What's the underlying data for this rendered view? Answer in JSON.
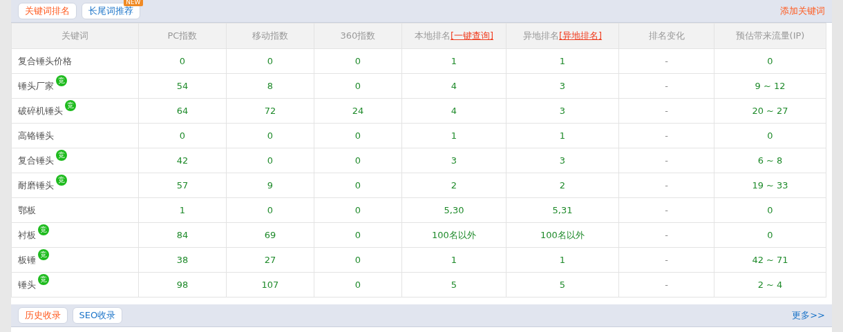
{
  "top_panel": {
    "tabs": [
      {
        "label": "关键词排名",
        "selected": true
      },
      {
        "label": "长尾词推荐",
        "selected": false,
        "badge": "NEW"
      }
    ],
    "action_link": "添加关键词"
  },
  "table": {
    "columns": [
      {
        "label": "关键词"
      },
      {
        "label": "PC指数"
      },
      {
        "label": "移动指数"
      },
      {
        "label": "360指数"
      },
      {
        "label": "本地排名",
        "link": "[一键查询]"
      },
      {
        "label": "异地排名",
        "link": "[异地排名]"
      },
      {
        "label": "排名变化"
      },
      {
        "label": "预估带来流量(IP)"
      }
    ],
    "rows": [
      {
        "keyword": "复合锤头价格",
        "pc": "0",
        "mobile": "0",
        "s360": "0",
        "local": "1",
        "remote": "1",
        "change": "-",
        "traffic": "0"
      },
      {
        "keyword": "锤头厂家",
        "badge": "竞",
        "pc": "54",
        "mobile": "8",
        "s360": "0",
        "local": "4",
        "remote": "3",
        "change": "-",
        "traffic": "9 ~ 12"
      },
      {
        "keyword": "破碎机锤头",
        "badge": "竞",
        "pc": "64",
        "mobile": "72",
        "s360": "24",
        "local": "4",
        "remote": "3",
        "change": "-",
        "traffic": "20 ~ 27"
      },
      {
        "keyword": "高铬锤头",
        "pc": "0",
        "mobile": "0",
        "s360": "0",
        "local": "1",
        "remote": "1",
        "change": "-",
        "traffic": "0"
      },
      {
        "keyword": "复合锤头",
        "badge": "竞",
        "pc": "42",
        "mobile": "0",
        "s360": "0",
        "local": "3",
        "remote": "3",
        "change": "-",
        "traffic": "6 ~ 8"
      },
      {
        "keyword": "耐磨锤头",
        "badge": "竞",
        "pc": "57",
        "mobile": "9",
        "s360": "0",
        "local": "2",
        "remote": "2",
        "change": "-",
        "traffic": "19 ~ 33"
      },
      {
        "keyword": "鄂板",
        "pc": "1",
        "mobile": "0",
        "s360": "0",
        "local": "5,30",
        "remote": "5,31",
        "change": "-",
        "traffic": "0"
      },
      {
        "keyword": "衬板",
        "badge": "竞",
        "pc": "84",
        "mobile": "69",
        "s360": "0",
        "local": "100名以外",
        "remote": "100名以外",
        "change": "-",
        "traffic": "0"
      },
      {
        "keyword": "板锤",
        "badge": "竞",
        "pc": "38",
        "mobile": "27",
        "s360": "0",
        "local": "1",
        "remote": "1",
        "change": "-",
        "traffic": "42 ~ 71"
      },
      {
        "keyword": "锤头",
        "badge": "竞",
        "pc": "98",
        "mobile": "107",
        "s360": "0",
        "local": "5",
        "remote": "5",
        "change": "-",
        "traffic": "2 ~ 4"
      }
    ]
  },
  "bottom_panel": {
    "tabs": [
      {
        "label": "历史收录",
        "selected": true
      },
      {
        "label": "SEO收录",
        "selected": false
      }
    ],
    "action_link": "更多>>"
  }
}
